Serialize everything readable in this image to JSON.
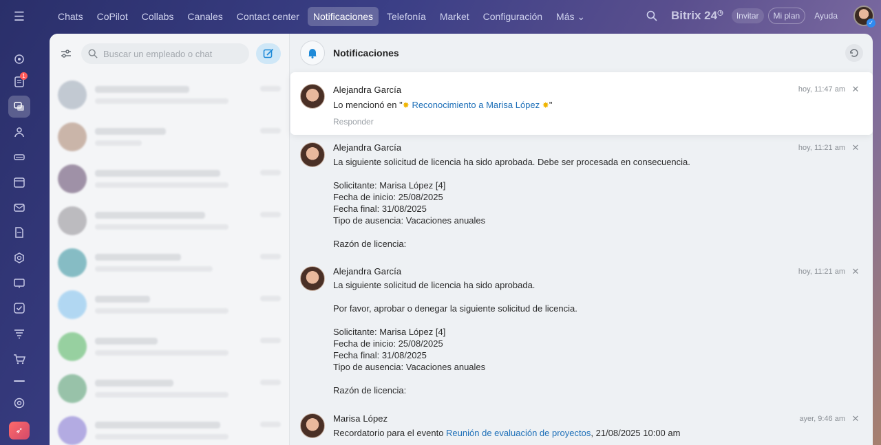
{
  "topnav": {
    "items": [
      {
        "label": "Chats",
        "active": false
      },
      {
        "label": "CoPilot",
        "active": false
      },
      {
        "label": "Collabs",
        "active": false
      },
      {
        "label": "Canales",
        "active": false
      },
      {
        "label": "Contact center",
        "active": false
      },
      {
        "label": "Notificaciones",
        "active": true
      },
      {
        "label": "Telefonía",
        "active": false
      },
      {
        "label": "Market",
        "active": false
      },
      {
        "label": "Configuración",
        "active": false
      },
      {
        "label": "Más ⌄",
        "active": false
      }
    ],
    "brand": "Bitrix 24",
    "brand_icon": "clock-icon",
    "invite": "Invitar",
    "plan": "Mi plan",
    "help": "Ayuda"
  },
  "rail": {
    "notifications_badge": "1"
  },
  "chat_list": {
    "search_placeholder": "Buscar un empleado o chat"
  },
  "notifications": {
    "title": "Notificaciones",
    "items": [
      {
        "author": "Alejandra García",
        "time": "hoy, 11:47 am",
        "text_prefix": "Lo mencionó en \"",
        "link": "Reconocimiento a Marisa López",
        "text_suffix": "\"",
        "reply": "Responder"
      },
      {
        "author": "Alejandra García",
        "time": "hoy, 11:21 am",
        "lines": [
          "La siguiente solicitud de licencia ha sido aprobada. Debe ser procesada en consecuencia.",
          "",
          "Solicitante: Marisa López [4]",
          "Fecha de inicio: 25/08/2025",
          "Fecha final: 31/08/2025",
          "Tipo de ausencia: Vacaciones anuales",
          "",
          "Razón de licencia:"
        ]
      },
      {
        "author": "Alejandra García",
        "time": "hoy, 11:21 am",
        "lines": [
          "La siguiente solicitud de licencia ha sido aprobada.",
          "",
          "Por favor, aprobar o denegar la siguiente solicitud de licencia.",
          "",
          "Solicitante: Marisa López [4]",
          "Fecha de inicio: 25/08/2025",
          "Fecha final: 31/08/2025",
          "Tipo de ausencia: Vacaciones anuales",
          "",
          "Razón de licencia:"
        ]
      },
      {
        "author": "Marisa López",
        "time": "ayer, 9:46 am",
        "text_prefix": "Recordatorio para el evento ",
        "link": "Reunión de evaluación de proyectos",
        "text_suffix": ", 21/08/2025 10:00 am"
      }
    ]
  }
}
